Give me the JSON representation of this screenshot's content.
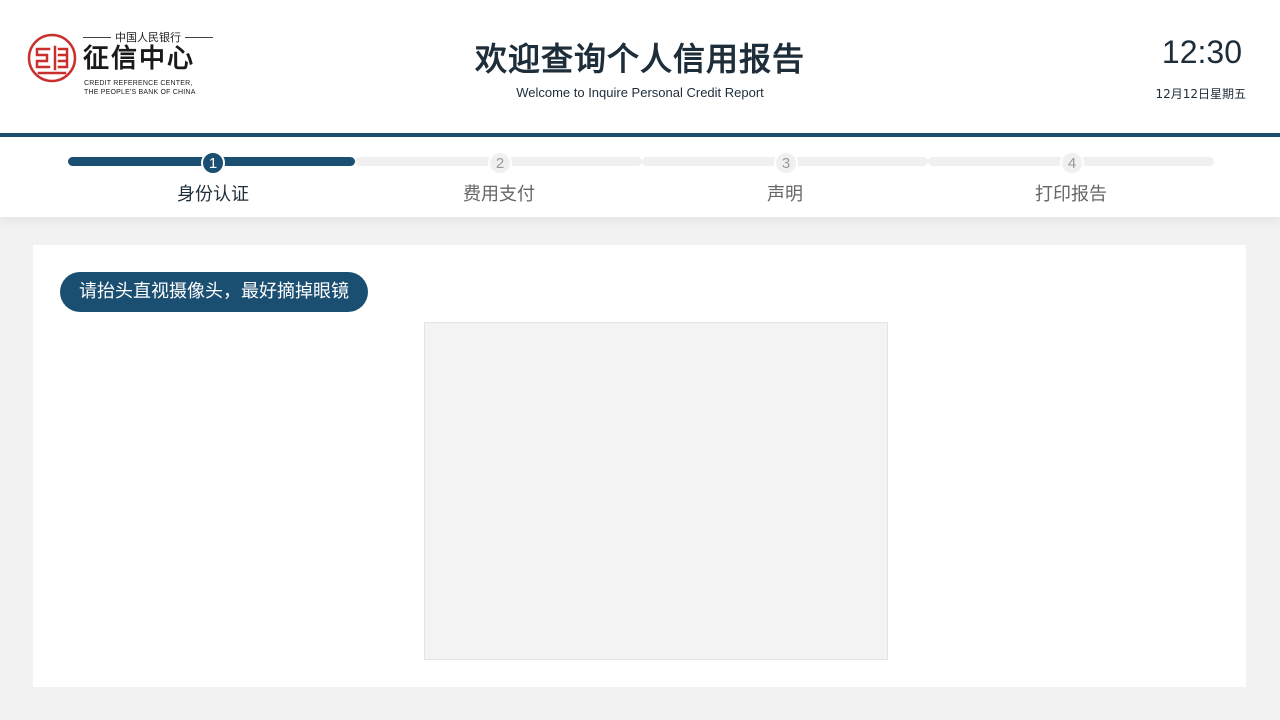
{
  "header": {
    "logo": {
      "top_text": "中国人民银行",
      "main_text": "征信中心",
      "en_line1": "CREDIT REFERENCE CENTER,",
      "en_line2": "THE PEOPLE'S BANK OF CHINA",
      "seal_color": "#c9302c"
    },
    "title": "欢迎查询个人信用报告",
    "subtitle": "Welcome to Inquire Personal Credit Report",
    "time": "12:30",
    "date": "12月12日星期五"
  },
  "steps": [
    {
      "number": "1",
      "label": "身份认证",
      "active": true
    },
    {
      "number": "2",
      "label": "费用支付",
      "active": false
    },
    {
      "number": "3",
      "label": "声明",
      "active": false
    },
    {
      "number": "4",
      "label": "打印报告",
      "active": false
    }
  ],
  "main": {
    "instruction": "请抬头直视摄像头，最好摘掉眼镜"
  },
  "colors": {
    "primary": "#1b4f72",
    "text": "#1e2d3a",
    "inactive": "#f0f0f0"
  }
}
